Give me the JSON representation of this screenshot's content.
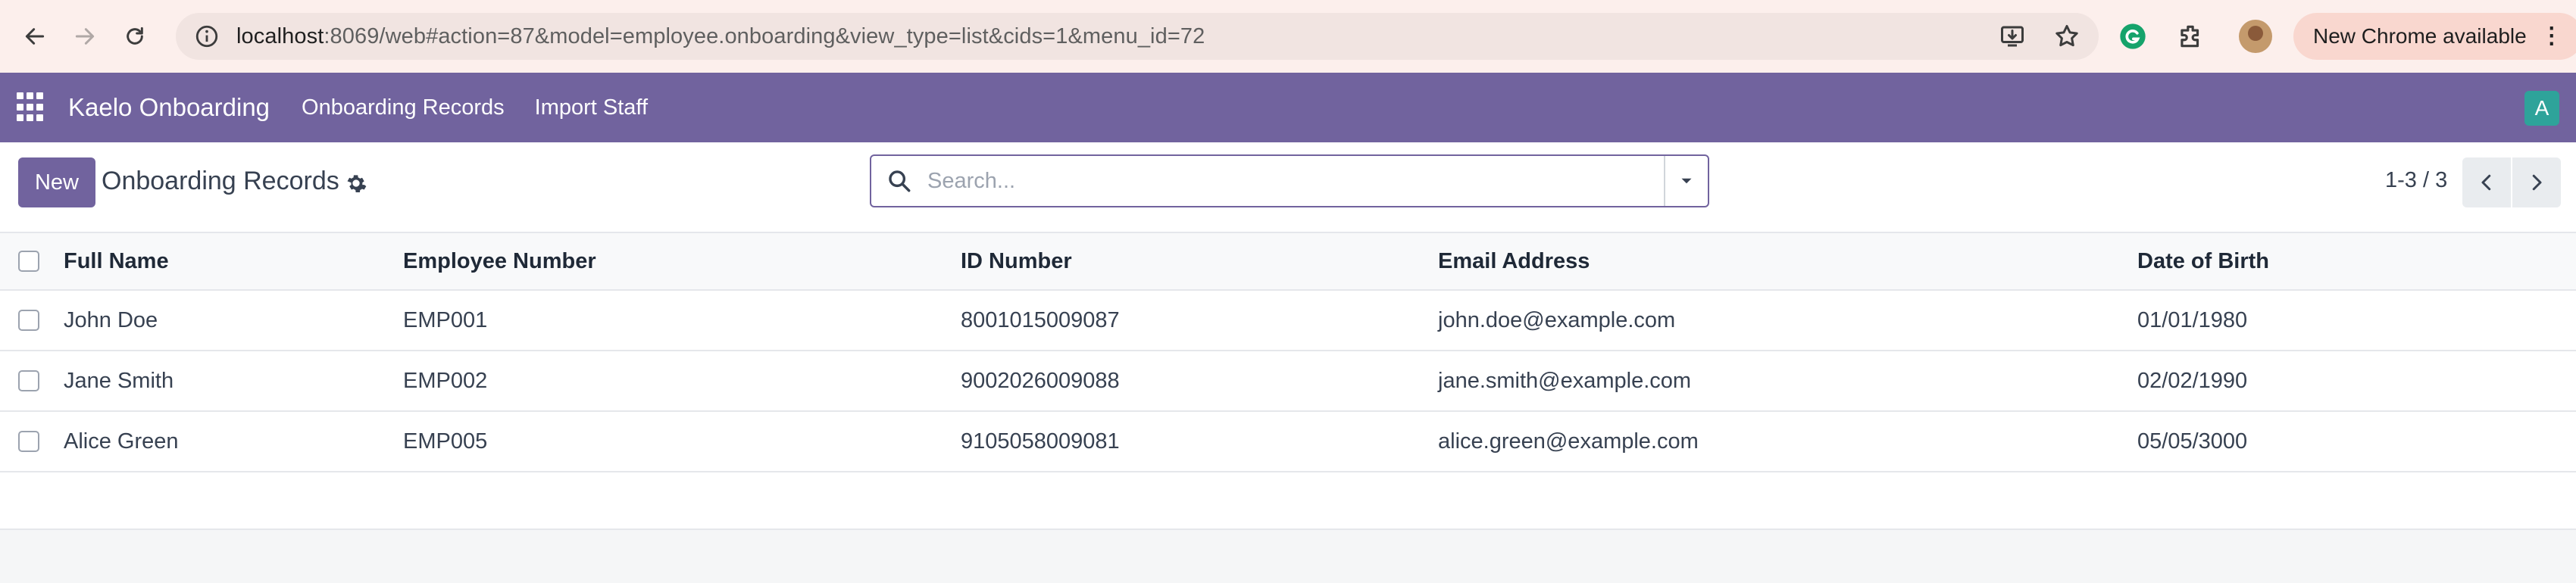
{
  "browser": {
    "url_host": "localhost",
    "url_rest": ":8069/web#action=87&model=employee.onboarding&view_type=list&cids=1&menu_id=72",
    "update_label": "New Chrome available"
  },
  "navbar": {
    "app_name": "Kaelo Onboarding",
    "menu": [
      "Onboarding Records",
      "Import Staff"
    ],
    "user_initial": "A",
    "accent_color": "#71639e"
  },
  "control": {
    "new_label": "New",
    "title": "Onboarding Records",
    "search_placeholder": "Search...",
    "pager": "1-3 / 3"
  },
  "table": {
    "columns": [
      "Full Name",
      "Employee Number",
      "ID Number",
      "Email Address",
      "Date of Birth"
    ],
    "rows": [
      [
        "John Doe",
        "EMP001",
        "8001015009087",
        "john.doe@example.com",
        "01/01/1980"
      ],
      [
        "Jane Smith",
        "EMP002",
        "9002026009088",
        "jane.smith@example.com",
        "02/02/1990"
      ],
      [
        "Alice Green",
        "EMP005",
        "9105058009081",
        "alice.green@example.com",
        "05/05/3000"
      ]
    ]
  }
}
